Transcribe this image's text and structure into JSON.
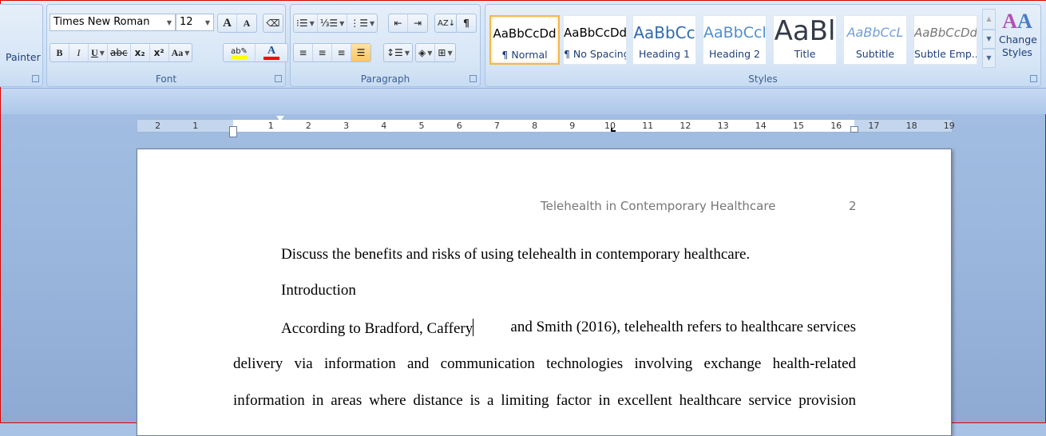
{
  "clipboard": {
    "painter_label": "Painter"
  },
  "font": {
    "group_label": "Font",
    "font_name": "Times New Roman",
    "font_size": "12",
    "grow": "A",
    "shrink": "A",
    "bold": "B",
    "italic": "I",
    "underline": "U",
    "strike": "abc",
    "subscript": "x₂",
    "superscript": "x²",
    "change_case": "Aa",
    "highlight_color": "#ffff00",
    "font_color": "#ff0000"
  },
  "paragraph": {
    "group_label": "Paragraph",
    "pilcrow": "¶",
    "active_alignment": "justify"
  },
  "styles": {
    "group_label": "Styles",
    "items": [
      {
        "preview": "AaBbCcDd",
        "name": "¶ Normal",
        "selected": true
      },
      {
        "preview": "AaBbCcDd",
        "name": "¶ No Spacing"
      },
      {
        "preview": "AaBbCc",
        "name": "Heading 1"
      },
      {
        "preview": "AaBbCcl",
        "name": "Heading 2"
      },
      {
        "preview": "AaBl",
        "name": "Title"
      },
      {
        "preview": "AaBbCcL",
        "name": "Subtitle"
      },
      {
        "preview": "AaBbCcDd",
        "name": "Subtle Emp..."
      }
    ],
    "change_styles": "Change Styles"
  },
  "ruler": {
    "left": [
      "2",
      "1"
    ],
    "right": [
      "1",
      "2",
      "3",
      "4",
      "5",
      "6",
      "7",
      "8",
      "9",
      "10",
      "11",
      "12",
      "13",
      "14",
      "15",
      "16",
      "17",
      "18",
      "19"
    ]
  },
  "document": {
    "header_title": "Telehealth in Contemporary Healthcare",
    "page_number": "2",
    "lines": [
      "Discuss the benefits and risks of using telehealth in contemporary healthcare.",
      "Introduction",
      "According to Bradford, Caffery",
      "and Smith (2016), telehealth refers to healthcare services",
      "delivery via information and communication technologies involving exchange health-related",
      "information in areas where distance is a limiting factor in excellent healthcare service provision"
    ]
  }
}
